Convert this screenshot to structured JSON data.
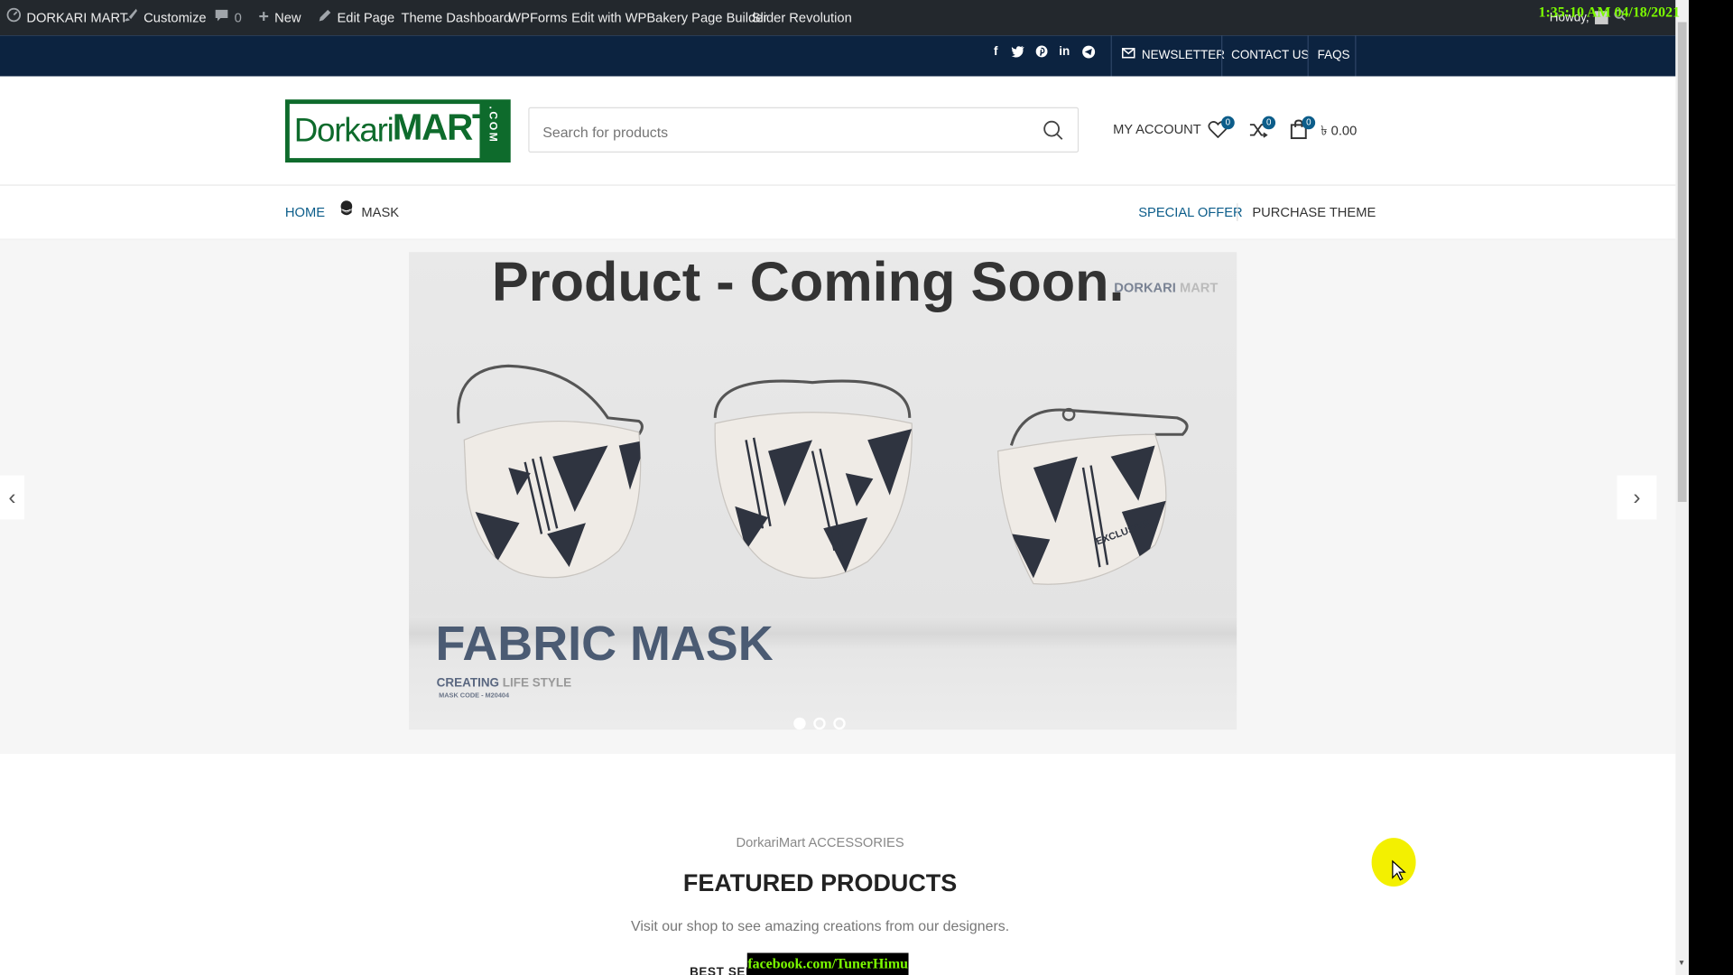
{
  "overlay": {
    "clock": "1:35:10 AM 04/18/2021",
    "watermark": "facebook.com/TunerHimu"
  },
  "adminbar": {
    "site_name": "DORKARI MART",
    "customize": "Customize",
    "comments_count": "0",
    "new": "New",
    "edit_page": "Edit Page",
    "theme_dashboard": "Theme Dashboard",
    "wpforms": "WPForms",
    "wpbakery": "Edit with WPBakery Page Builder",
    "slider_revolution": "Slider Revolution",
    "howdy": "Howdy, "
  },
  "topbar": {
    "social": [
      "facebook-icon",
      "twitter-icon",
      "pinterest-icon",
      "linkedin-icon",
      "telegram-icon"
    ],
    "newsletter": "NEWSLETTER",
    "contact": "CONTACT US",
    "faqs": "FAQS"
  },
  "header": {
    "logo": {
      "part1": "Dorkari",
      "part2": "MART",
      "part3": ".COM"
    },
    "search_placeholder": "Search for products",
    "my_account": "MY ACCOUNT",
    "wishlist_count": "0",
    "compare_count": "0",
    "cart_count": "0",
    "cart_total": "৳ 0.00"
  },
  "nav": {
    "home": "HOME",
    "mask": "MASK",
    "special_offer": "SPECIAL OFFER",
    "purchase_theme": "PURCHASE THEME"
  },
  "colors": {
    "nav_active": "#0c5d8a",
    "topbar_bg": "#0c2340",
    "logo_green": "#0e6b2c"
  },
  "slider": {
    "title": "Product - Coming Soon.",
    "brand_a": "DORKARI",
    "brand_b": " MART",
    "headline": "FABRIC MASK",
    "tag_a": "CREATING",
    "tag_b": " LIFE STYLE",
    "code": "MASK CODE - M20404",
    "mask_print": "EXCLUSIVE",
    "active_slide": 1,
    "slide_count": 3
  },
  "featured": {
    "subtitle": "DorkariMart ACCESSORIES",
    "title": "FEATURED PRODUCTS",
    "description": "Visit our shop to see amazing creations from our designers.",
    "tabs_visible": "BEST SELLERS"
  }
}
